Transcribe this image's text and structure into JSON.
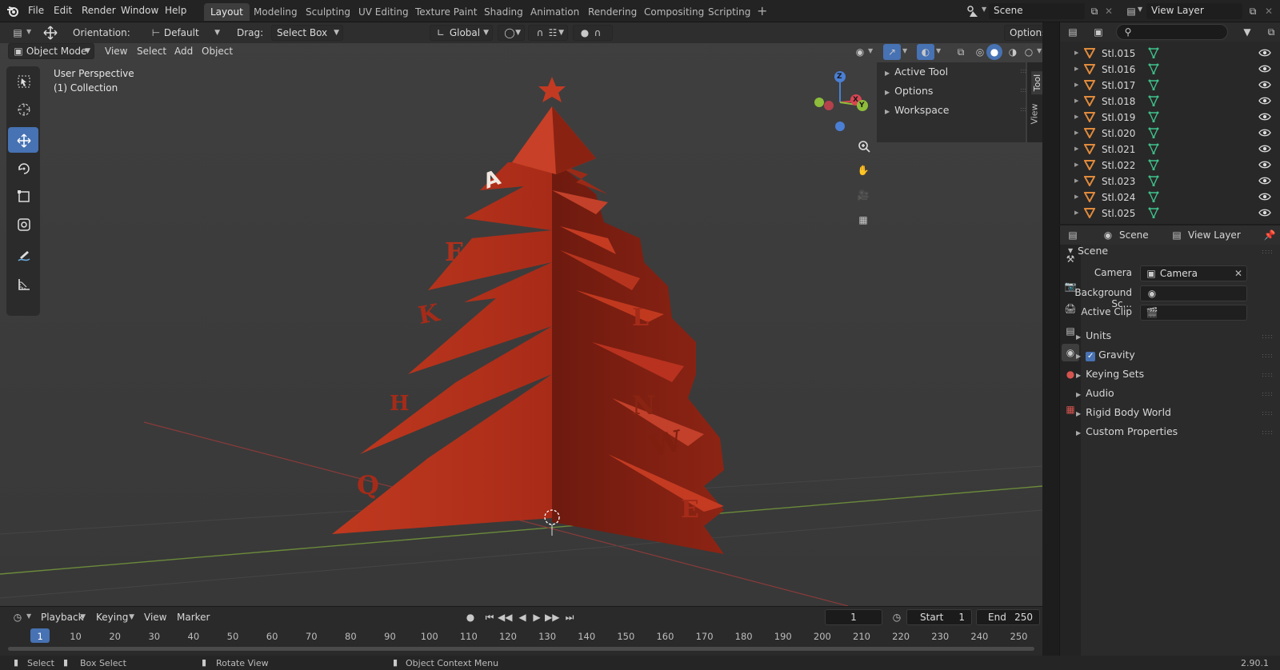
{
  "menu": [
    "File",
    "Edit",
    "Render",
    "Window",
    "Help"
  ],
  "workspaces": [
    "Layout",
    "Modeling",
    "Sculpting",
    "UV Editing",
    "Texture Paint",
    "Shading",
    "Animation",
    "Rendering",
    "Compositing",
    "Scripting"
  ],
  "active_workspace": "Layout",
  "scene_field": "Scene",
  "view_layer_field": "View Layer",
  "tool_header": {
    "orientation_label": "Orientation:",
    "orientation_value": "Default",
    "drag_label": "Drag:",
    "drag_value": "Select Box",
    "transform_orientation": "Global",
    "options_label": "Options"
  },
  "viewport_header": {
    "mode": "Object Mode",
    "menus": [
      "View",
      "Select",
      "Add",
      "Object"
    ]
  },
  "viewport_overlay": {
    "perspective": "User Perspective",
    "collection": "(1) Collection"
  },
  "toolbar_icons": [
    "select-box-icon",
    "cursor-icon",
    "move-icon",
    "rotate-icon",
    "scale-icon",
    "transform-icon",
    "annotate-icon",
    "measure-icon"
  ],
  "n_panel": {
    "rows": [
      "Active Tool",
      "Options",
      "Workspace"
    ],
    "tabs": [
      "Tool",
      "View"
    ]
  },
  "gizmo_axes": [
    "Z",
    "X",
    "Y"
  ],
  "tree_letters": [
    "A",
    "F",
    "K",
    "Q",
    "L",
    "W",
    "E",
    "H",
    "N"
  ],
  "timeline": {
    "menus": [
      "Playback",
      "Keying",
      "View",
      "Marker"
    ],
    "current_frame": "1",
    "start_label": "Start",
    "start_value": "1",
    "end_label": "End",
    "end_value": "250",
    "ruler": [
      "1",
      "10",
      "20",
      "30",
      "40",
      "50",
      "60",
      "70",
      "80",
      "90",
      "100",
      "110",
      "120",
      "130",
      "140",
      "150",
      "160",
      "170",
      "180",
      "190",
      "200",
      "210",
      "220",
      "230",
      "240",
      "250"
    ]
  },
  "statusbar": {
    "select": "Select",
    "box_select": "Box Select",
    "rotate_view": "Rotate View",
    "context_menu": "Object Context Menu",
    "version": "2.90.1"
  },
  "outliner": {
    "items": [
      "Stl.015",
      "Stl.016",
      "Stl.017",
      "Stl.018",
      "Stl.019",
      "Stl.020",
      "Stl.021",
      "Stl.022",
      "Stl.023",
      "Stl.024",
      "Stl.025"
    ]
  },
  "properties": {
    "header_scene": "Scene",
    "header_view_layer": "View Layer",
    "panel_title": "Scene",
    "camera_label": "Camera",
    "camera_value": "Camera",
    "background_label": "Background Sc...",
    "active_clip_label": "Active Clip",
    "sections": [
      "Units",
      "Gravity",
      "Keying Sets",
      "Audio",
      "Rigid Body World",
      "Custom Properties"
    ]
  },
  "colors": {
    "accent": "#4772b3",
    "tree": "#b8321f",
    "outliner_mesh": "#e08a3c",
    "outliner_data": "#3fbf8a"
  }
}
